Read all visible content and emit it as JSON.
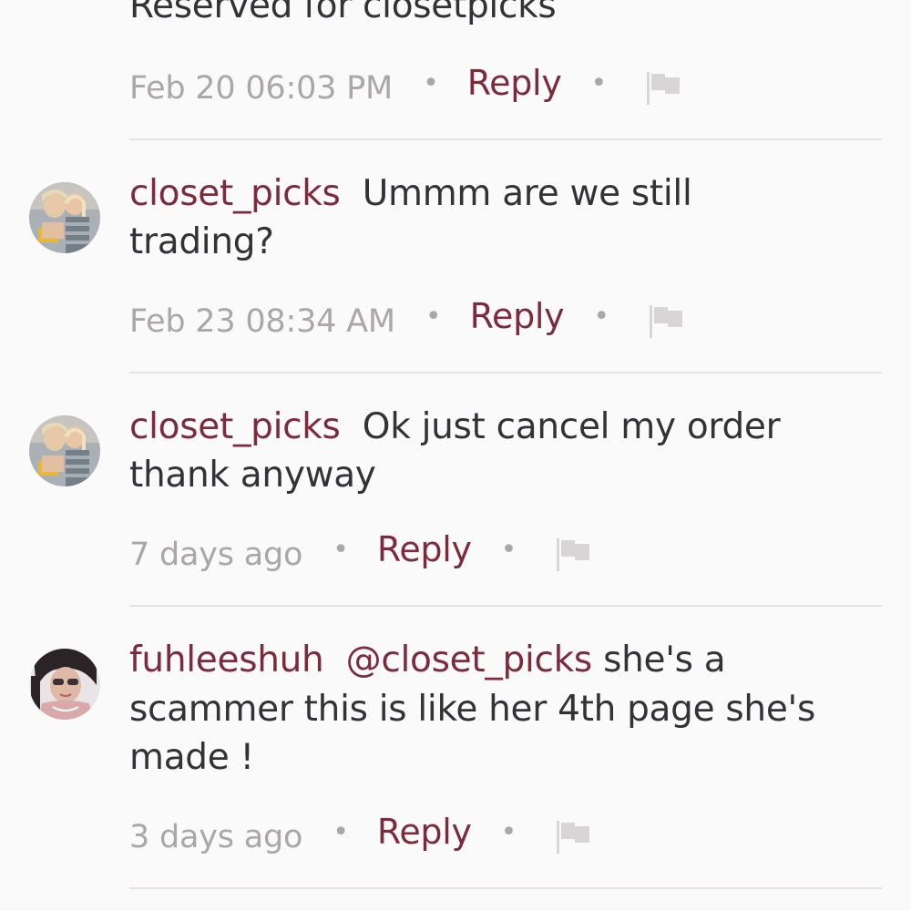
{
  "comments": [
    {
      "text": "Reserved for closetpicks",
      "timestamp": "Feb 20 06:03 PM",
      "reply_label": "Reply",
      "flag_icon": "flag-icon"
    },
    {
      "username": "closet_picks",
      "text_line1": "Ummm are we still",
      "text_line2": "trading?",
      "timestamp": "Feb 23 08:34 AM",
      "reply_label": "Reply",
      "flag_icon": "flag-icon"
    },
    {
      "username": "closet_picks",
      "text_line1": "Ok just cancel my order",
      "text_line2": "thank anyway",
      "timestamp": "7 days ago",
      "reply_label": "Reply",
      "flag_icon": "flag-icon"
    },
    {
      "username": "fuhleeshuh",
      "mention": "@closet_picks",
      "text_line1": "she's a",
      "text_line2": "scammer this is like her 4th page she's",
      "text_line3": "made !",
      "timestamp": "3 days ago",
      "reply_label": "Reply",
      "flag_icon": "flag-icon"
    }
  ],
  "colors": {
    "accent": "#7e2a3d",
    "text": "#333335",
    "muted": "#a9a7a7",
    "divider": "#e4e2e3",
    "background": "#fbfafb"
  },
  "separator": "•"
}
